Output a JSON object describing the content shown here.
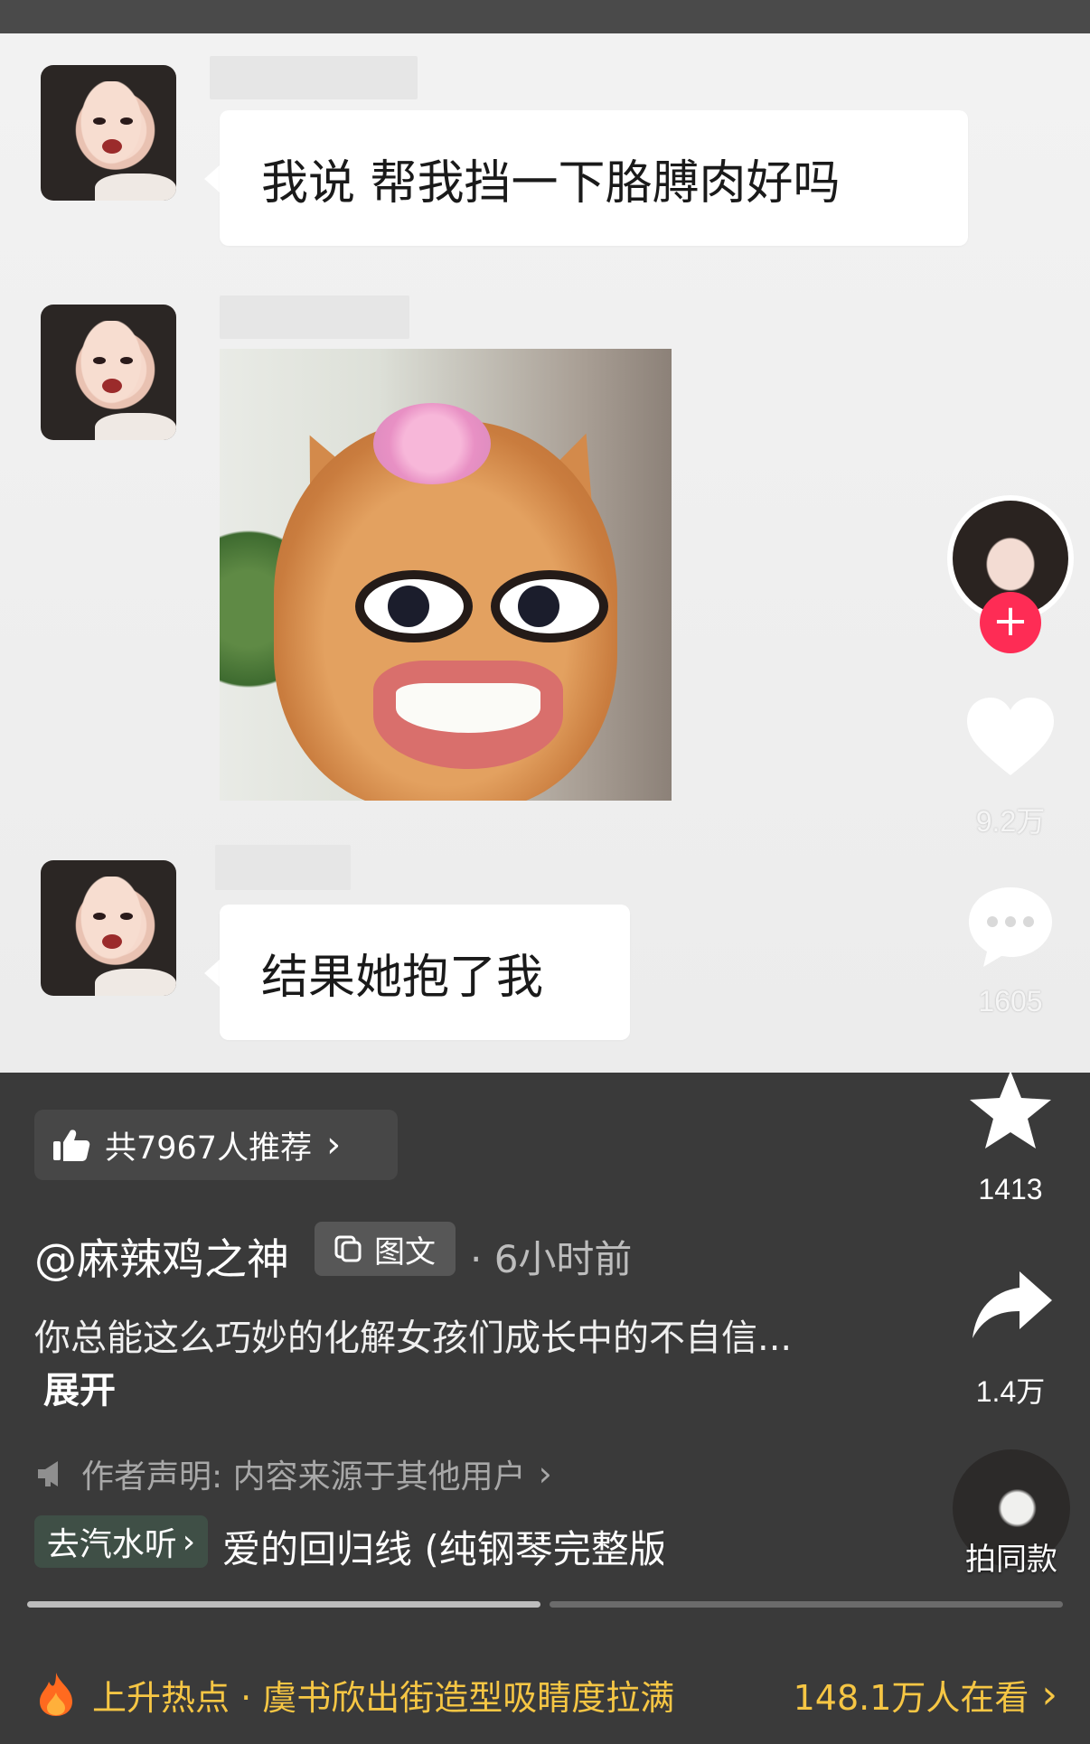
{
  "messages": [
    {
      "type": "text",
      "text": "我说 帮我挡一下胳膊肉好吗"
    },
    {
      "type": "image",
      "icon": "smiling-cat-sticker"
    },
    {
      "type": "text",
      "text": "结果她抱了我"
    }
  ],
  "rail": {
    "follow_symbol": "+",
    "likes": "9.2万",
    "comments": "1605",
    "favorites": "1413",
    "shares": "1.4万"
  },
  "recommend": {
    "text": "共7967人推荐",
    "chevron": "›"
  },
  "post": {
    "author": "@麻辣鸡之神",
    "type_tag": "图文",
    "time": "· 6小时前",
    "description": "你总能这么巧妙的化解女孩们成长中的不自信...",
    "expand_label": "展开",
    "declaration": "作者声明: 内容来源于其他用户",
    "declaration_chevron": "›"
  },
  "music": {
    "tag_label": "去汽水听",
    "tag_chevron": "›",
    "title": "爱的回归线 (纯钢琴完整版"
  },
  "same_style": {
    "label": "拍同款"
  },
  "progress": {
    "segments": 2,
    "current": 1
  },
  "hot": {
    "text": "上升热点 · 虞书欣出街造型吸睛度拉满",
    "watching": "148.1万人在看",
    "chevron": "›",
    "accent": "#f6c644"
  },
  "colors": {
    "follow": "#fe2c55",
    "panel": "#3a3a3a",
    "chat_bg": "#f2f2f2"
  }
}
